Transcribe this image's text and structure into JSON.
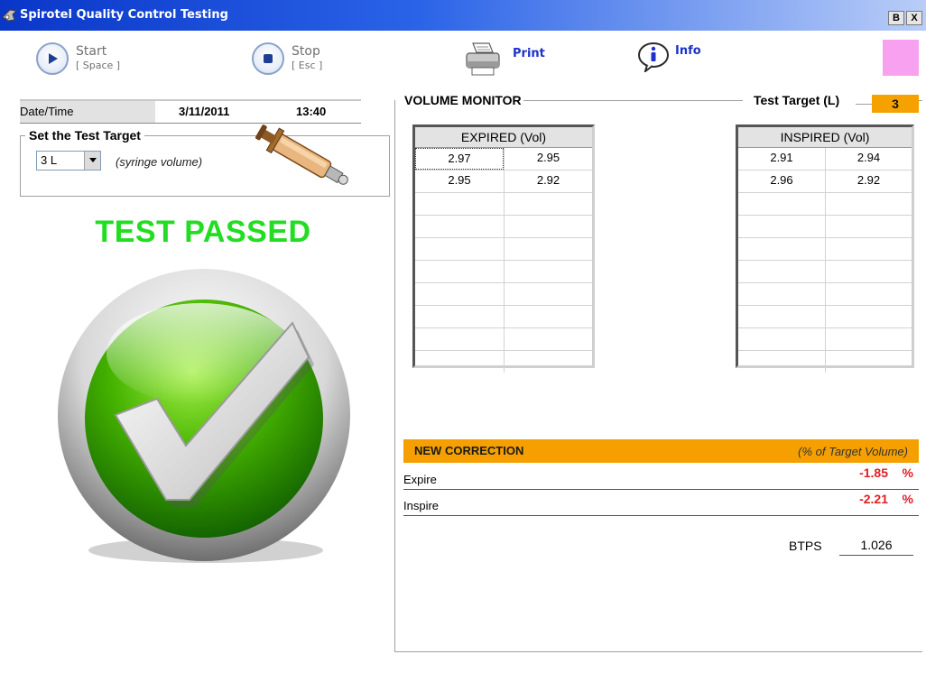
{
  "window": {
    "title": "Spirotel Quality Control Testing",
    "restore_label": "B",
    "close_label": "X"
  },
  "toolbar": {
    "start": {
      "label": "Start",
      "shortcut": "[ Space ]"
    },
    "stop": {
      "label": "Stop",
      "shortcut": "[ Esc ]"
    },
    "print": {
      "label": "Print"
    },
    "info": {
      "label": "Info"
    },
    "indicator_color": "#f7a1f0"
  },
  "datetime": {
    "label": "Date/Time",
    "date": "3/11/2011",
    "time": "13:40"
  },
  "test_target_setting": {
    "legend": "Set the Test Target",
    "selected": "3 L",
    "note": "(syringe volume)"
  },
  "status": {
    "text": "TEST PASSED",
    "color": "#22dd22"
  },
  "volume_monitor": {
    "legend": "VOLUME MONITOR",
    "target_label": "Test Target (L)",
    "target_value": "3",
    "expired": {
      "title": "EXPIRED (Vol)",
      "rows": [
        [
          "2.97",
          "2.95"
        ],
        [
          "2.95",
          "2.92"
        ],
        [
          "",
          ""
        ],
        [
          "",
          ""
        ],
        [
          "",
          ""
        ],
        [
          "",
          ""
        ],
        [
          "",
          ""
        ],
        [
          "",
          ""
        ],
        [
          "",
          ""
        ],
        [
          "",
          ""
        ]
      ]
    },
    "inspired": {
      "title": "INSPIRED (Vol)",
      "rows": [
        [
          "2.91",
          "2.94"
        ],
        [
          "2.96",
          "2.92"
        ],
        [
          "",
          ""
        ],
        [
          "",
          ""
        ],
        [
          "",
          ""
        ],
        [
          "",
          ""
        ],
        [
          "",
          ""
        ],
        [
          "",
          ""
        ],
        [
          "",
          ""
        ],
        [
          "",
          ""
        ]
      ]
    }
  },
  "correction": {
    "title": "NEW CORRECTION",
    "unit": "(% of Target Volume)",
    "expire": {
      "label": "Expire",
      "value": "-1.85",
      "pct": "%"
    },
    "inspire": {
      "label": "Inspire",
      "value": "-2.21",
      "pct": "%"
    },
    "btps_label": "BTPS",
    "btps_value": "1.026"
  },
  "colors": {
    "accent_orange": "#f5a000",
    "error_red": "#e02020",
    "title_bar_blue": "#0a36c8"
  }
}
